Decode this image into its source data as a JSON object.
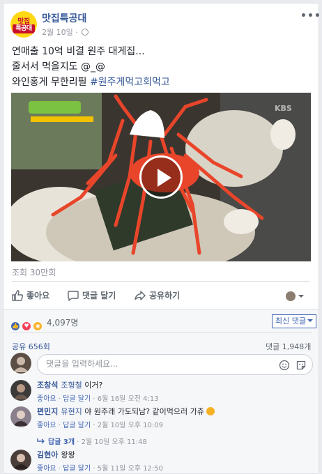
{
  "post": {
    "page_name": "맛집특공대",
    "logo_line1": "맛집",
    "logo_line2": "특공대",
    "date": "2월 10일",
    "separator": "·",
    "text_line1": "연매출 10억 비결 원주 대게집...",
    "text_line2": "줄서서 먹을지도 @_@",
    "text_line3_prefix": "와인홍게 무한리필 ",
    "hashtag": "#원주게먹고회먹고",
    "video_watermark": "KBS",
    "views": "조회 30만회"
  },
  "actions": {
    "like": "좋아요",
    "comment": "댓글 달기",
    "share": "공유하기"
  },
  "stats": {
    "reaction_count": "4,097명",
    "sort_label": "최신 댓글",
    "shares": "공유 656회",
    "comments": "댓글 1,948개"
  },
  "comment_input": {
    "placeholder": "댓글을 입력하세요..."
  },
  "comments": [
    {
      "author": "조창석",
      "tag": "조형철",
      "text": " 이거?",
      "like": "좋아요",
      "reply": "답글 달기",
      "time": "6월 16일 오전 4:13",
      "dot": "·"
    },
    {
      "author": "편민지",
      "tag": "유현지",
      "text": " 야 원주래 가도되남? 같이먹으러 가쥬",
      "like": "좋아요",
      "reply": "답글 달기",
      "time": "2월 10일 오후 10:09",
      "dot": "·"
    },
    {
      "author": "김현아",
      "tag": "",
      "text": "왕왕",
      "like": "좋아요",
      "reply": "답글 달기",
      "time": "5월 11일 오후 12:50",
      "dot": "·"
    }
  ],
  "replies": {
    "label": "답글 3개",
    "time": "2월 10일 오후 11:48",
    "dot": "·"
  },
  "colors": {
    "link": "#365899",
    "accent": "#4267b2",
    "logo_bg": "#ffd814",
    "logo_red": "#c8102e"
  }
}
